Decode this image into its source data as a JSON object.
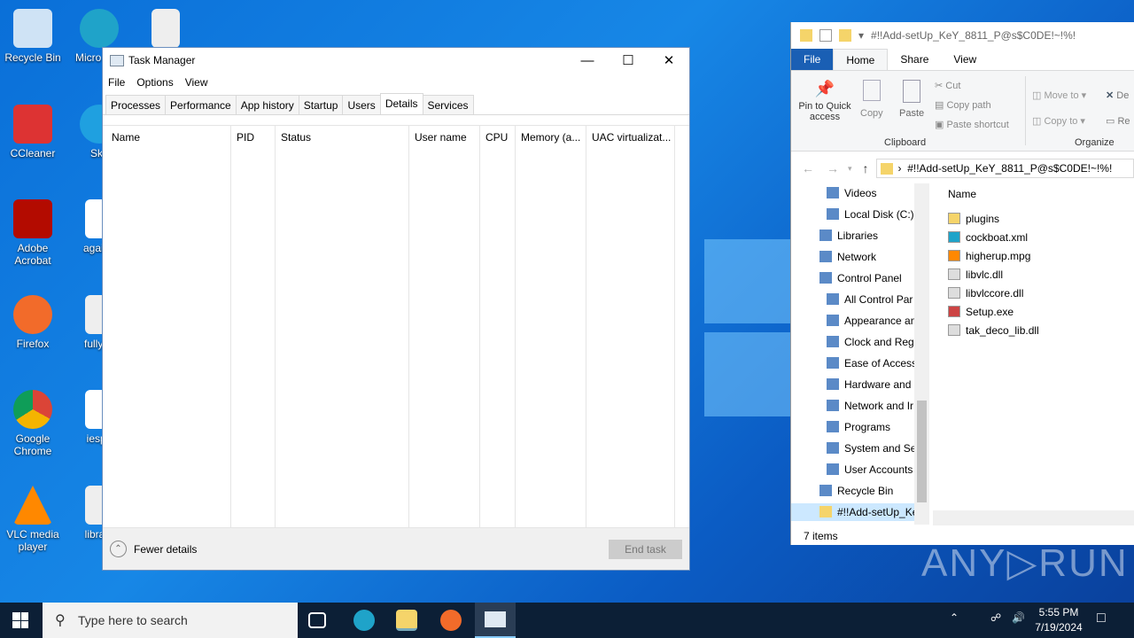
{
  "desktop": {
    "icons": [
      {
        "label": "Recycle Bin"
      },
      {
        "label": "Micro Edg"
      },
      {
        "label": "CCleaner"
      },
      {
        "label": "Sky"
      },
      {
        "label": "Adobe Acrobat"
      },
      {
        "label": "againb"
      },
      {
        "label": "Firefox"
      },
      {
        "label": "fullyev"
      },
      {
        "label": "Google Chrome"
      },
      {
        "label": "iespa"
      },
      {
        "label": "VLC media player"
      },
      {
        "label": "library"
      }
    ]
  },
  "taskmanager": {
    "title": "Task Manager",
    "menu": [
      "File",
      "Options",
      "View"
    ],
    "tabs": [
      "Processes",
      "Performance",
      "App history",
      "Startup",
      "Users",
      "Details",
      "Services"
    ],
    "active_tab": "Details",
    "columns": [
      "Name",
      "PID",
      "Status",
      "User name",
      "CPU",
      "Memory (a...",
      "UAC virtualizat..."
    ],
    "fewer_details": "Fewer details",
    "end_task": "End task"
  },
  "explorer": {
    "title": "#!!Add-setUp_KeY_8811_P@s$C0DE!~!%!",
    "ribbon_tabs": [
      "File",
      "Home",
      "Share",
      "View"
    ],
    "clipboard": {
      "pin": "Pin to Quick access",
      "copy": "Copy",
      "paste": "Paste",
      "cut": "Cut",
      "copy_path": "Copy path",
      "paste_shortcut": "Paste shortcut",
      "group": "Clipboard"
    },
    "organize": {
      "move_to": "Move to",
      "copy_to": "Copy to",
      "delete": "De",
      "rename": "Re",
      "group": "Organize"
    },
    "address": "#!!Add-setUp_KeY_8811_P@s$C0DE!~!%!",
    "tree": [
      "Videos",
      "Local Disk (C:)",
      "Libraries",
      "Network",
      "Control Panel",
      "All Control Par",
      "Appearance an",
      "Clock and Regi",
      "Ease of Access",
      "Hardware and",
      "Network and Ir",
      "Programs",
      "System and Sec",
      "User Accounts",
      "Recycle Bin",
      "#!!Add-setUp_Ke"
    ],
    "column": "Name",
    "files": [
      "plugins",
      "cockboat.xml",
      "higherup.mpg",
      "libvlc.dll",
      "libvlccore.dll",
      "Setup.exe",
      "tak_deco_lib.dll"
    ],
    "status": "7 items"
  },
  "watermark": "ANY RUN",
  "taskbar": {
    "search_placeholder": "Type here to search",
    "time": "5:55 PM",
    "date": "7/19/2024"
  }
}
